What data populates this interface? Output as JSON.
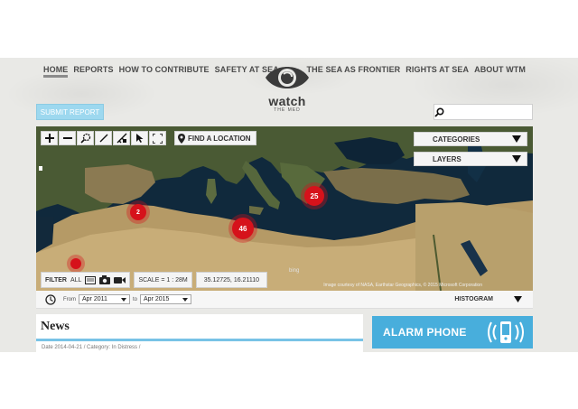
{
  "nav_left": [
    {
      "label": "HOME",
      "active": true
    },
    {
      "label": "REPORTS",
      "active": false
    },
    {
      "label": "HOW TO CONTRIBUTE",
      "active": false
    },
    {
      "label": "SAFETY AT SEA",
      "active": false
    }
  ],
  "nav_right": [
    {
      "label": "THE SEA AS FRONTIER"
    },
    {
      "label": "RIGHTS AT SEA"
    },
    {
      "label": "ABOUT WTM"
    }
  ],
  "logo": {
    "title": "watch",
    "subtitle": "THE MED"
  },
  "submit": {
    "label": "SUBMIT REPORT"
  },
  "search": {
    "placeholder": "",
    "value": ""
  },
  "map": {
    "toolbar_icons": [
      "zoom-in-icon",
      "zoom-out-icon",
      "zoom-box-icon",
      "measure-icon",
      "measure-area-icon",
      "pointer-icon",
      "fullscreen-icon"
    ],
    "find_location": "FIND A LOCATION",
    "categories": "CATEGORIES",
    "layers": "LAYERS",
    "clusters": [
      {
        "count": "25"
      },
      {
        "count": "2"
      },
      {
        "count": "46"
      }
    ],
    "filter_label": "FILTER",
    "filter_all": "ALL",
    "scale": "SCALE = 1 : 28M",
    "coords": "35.12725, 16.21110",
    "credit": "Image courtesy of NASA, Earthstar Geographics, © 2015 Microsoft Corporation",
    "credit_brand": "bing"
  },
  "timeline": {
    "from_label": "From",
    "from_value": "Apr 2011",
    "to_label": "to",
    "to_value": "Apr 2015",
    "histogram": "HISTOGRAM"
  },
  "news": {
    "title": "News",
    "meta": "Date 2014-04-21 / Category: In Distress /"
  },
  "alarm": {
    "label": "ALARM PHONE"
  },
  "colors": {
    "accent": "#48aedc",
    "cluster": "#d6121b",
    "submit": "#9dd8ef"
  }
}
